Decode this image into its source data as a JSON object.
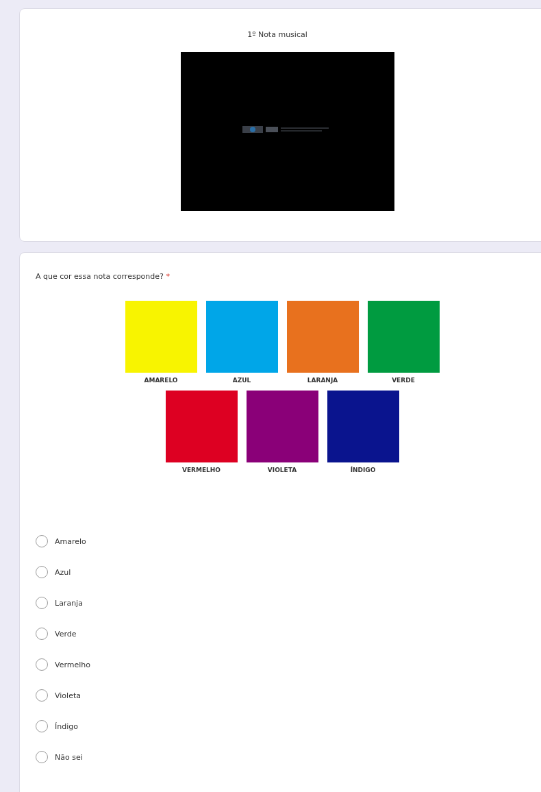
{
  "media_card": {
    "title": "1º Nota musical"
  },
  "question": {
    "text": "A que cor essa nota corresponde?",
    "required_mark": "*",
    "swatch_rows": [
      [
        {
          "label": "AMARELO",
          "color": "#f8f400"
        },
        {
          "label": "AZUL",
          "color": "#00a6e8"
        },
        {
          "label": "LARANJA",
          "color": "#e8711e"
        },
        {
          "label": "VERDE",
          "color": "#009b40"
        }
      ],
      [
        {
          "label": "VERMELHO",
          "color": "#dd0022"
        },
        {
          "label": "VIOLETA",
          "color": "#8a0078"
        },
        {
          "label": "ÍNDIGO",
          "color": "#0a148e"
        }
      ]
    ],
    "options": [
      {
        "label": "Amarelo",
        "selected": false
      },
      {
        "label": "Azul",
        "selected": false
      },
      {
        "label": "Laranja",
        "selected": false
      },
      {
        "label": "Verde",
        "selected": false
      },
      {
        "label": "Vermelho",
        "selected": false
      },
      {
        "label": "Violeta",
        "selected": false
      },
      {
        "label": "Índigo",
        "selected": false
      },
      {
        "label": "Não sei",
        "selected": false
      }
    ]
  }
}
